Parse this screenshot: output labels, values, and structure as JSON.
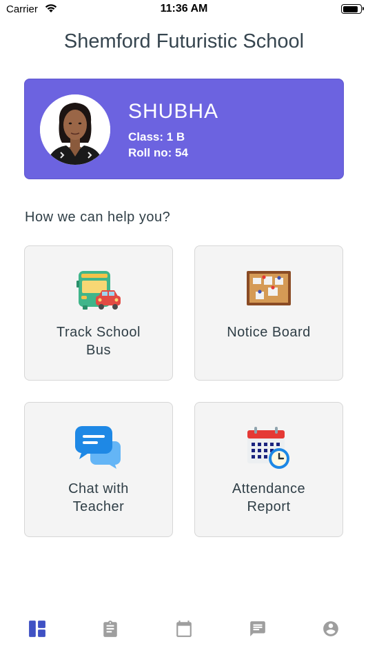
{
  "status_bar": {
    "carrier": "Carrier",
    "time": "11:36 AM",
    "battery_level": 0.9
  },
  "header": {
    "title": "Shemford Futuristic School"
  },
  "profile": {
    "name": "SHUBHA",
    "class_line": "Class: 1 B",
    "roll_line": "Roll no: 54",
    "card_color": "#6c63e0"
  },
  "help": {
    "heading": "How we can help you?"
  },
  "tiles": [
    {
      "icon": "school-bus-icon",
      "label_line1": "Track School",
      "label_line2": "Bus"
    },
    {
      "icon": "notice-board-icon",
      "label_line1": "Notice Board",
      "label_line2": ""
    },
    {
      "icon": "chat-bubbles-icon",
      "label_line1": "Chat with",
      "label_line2": "Teacher"
    },
    {
      "icon": "calendar-clock-icon",
      "label_line1": "Attendance",
      "label_line2": "Report"
    }
  ],
  "tab_bar": {
    "active_color": "#3f51c4",
    "inactive_color": "#9e9e9e",
    "tabs": [
      {
        "icon": "dashboard-icon",
        "active": true
      },
      {
        "icon": "clipboard-icon",
        "active": false
      },
      {
        "icon": "calendar-icon",
        "active": false
      },
      {
        "icon": "message-icon",
        "active": false
      },
      {
        "icon": "account-icon",
        "active": false
      }
    ]
  }
}
